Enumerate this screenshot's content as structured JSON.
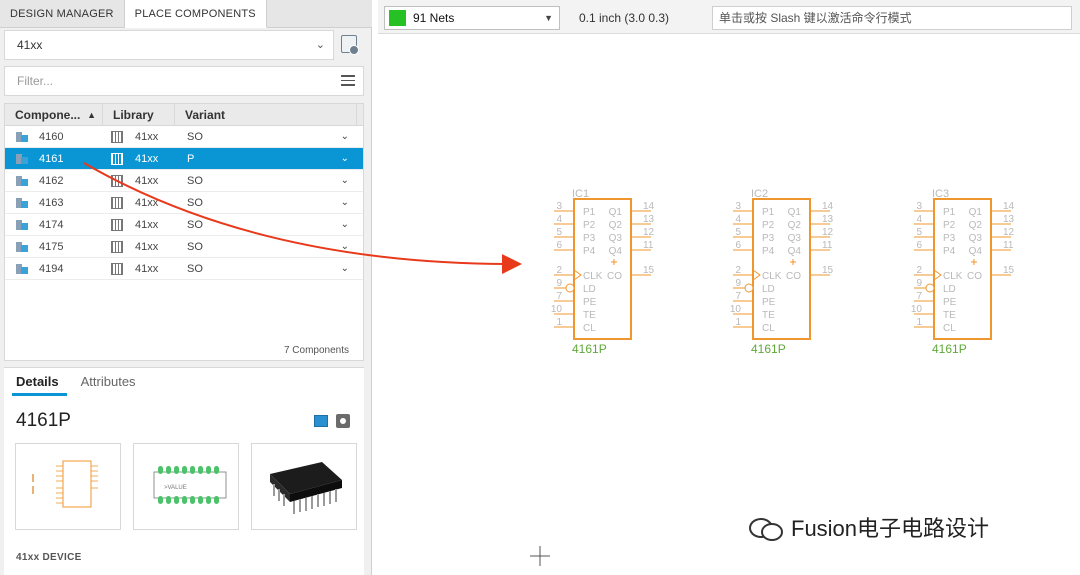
{
  "tabs": [
    "DESIGN MANAGER",
    "PLACE COMPONENTS"
  ],
  "library_select": {
    "value": "41xx"
  },
  "filter": {
    "placeholder": "Filter..."
  },
  "table": {
    "columns": [
      "Compone...",
      "Library",
      "Variant"
    ],
    "rows": [
      {
        "name": "4160",
        "library": "41xx",
        "variant": "SO",
        "selected": false
      },
      {
        "name": "4161",
        "library": "41xx",
        "variant": "P",
        "selected": true
      },
      {
        "name": "4162",
        "library": "41xx",
        "variant": "SO",
        "selected": false
      },
      {
        "name": "4163",
        "library": "41xx",
        "variant": "SO",
        "selected": false
      },
      {
        "name": "4174",
        "library": "41xx",
        "variant": "SO",
        "selected": false
      },
      {
        "name": "4175",
        "library": "41xx",
        "variant": "SO",
        "selected": false
      },
      {
        "name": "4194",
        "library": "41xx",
        "variant": "SO",
        "selected": false
      }
    ],
    "count_label": "7 Components"
  },
  "details": {
    "tabs": [
      "Details",
      "Attributes"
    ],
    "device_name": "4161P",
    "footer": "41xx DEVICE",
    "preview2_label": ">VALUE"
  },
  "toolbar": {
    "nets_label": "91 Nets",
    "nets_color": "#25c125",
    "grid_info": "0.1 inch (3.0 0.3)",
    "command_placeholder": "单击或按 Slash 键以激活命令行模式"
  },
  "schematic": {
    "color": "#f0962e",
    "pin_text_color": "#b9b9b9",
    "value_color": "#5fa83a",
    "parts": [
      {
        "ref": "IC1",
        "value": "4161P"
      },
      {
        "ref": "IC2",
        "value": "4161P"
      },
      {
        "ref": "IC3",
        "value": "4161P"
      }
    ],
    "left_pins": [
      {
        "num": "3",
        "label": "P1"
      },
      {
        "num": "4",
        "label": "P2"
      },
      {
        "num": "5",
        "label": "P3"
      },
      {
        "num": "6",
        "label": "P4"
      },
      {
        "num": "2",
        "label": "CLK"
      },
      {
        "num": "9",
        "label": "LD"
      },
      {
        "num": "7",
        "label": "PE"
      },
      {
        "num": "10",
        "label": "TE"
      },
      {
        "num": "1",
        "label": "CL"
      }
    ],
    "right_pins": [
      {
        "num": "14",
        "label": "Q1"
      },
      {
        "num": "13",
        "label": "Q2"
      },
      {
        "num": "12",
        "label": "Q3"
      },
      {
        "num": "11",
        "label": "Q4"
      },
      {
        "num": "15",
        "label": "CO"
      }
    ]
  },
  "watermark": "Fusion电子电路设计"
}
